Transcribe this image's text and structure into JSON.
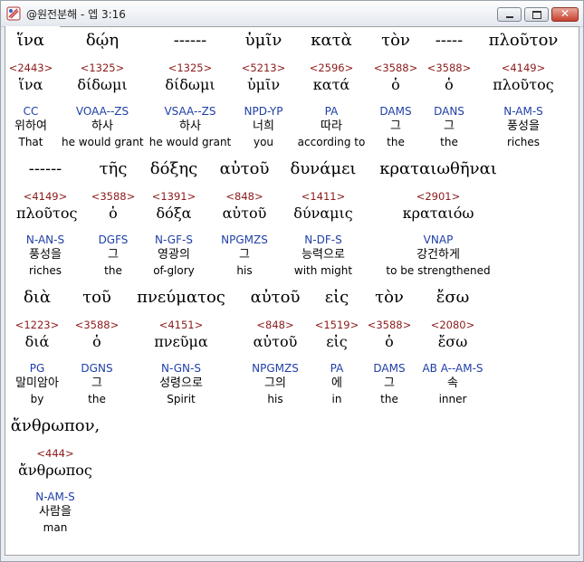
{
  "window": {
    "title": "@원전분해 - 엡 3:16"
  },
  "words": [
    {
      "greek": "ἵνα",
      "strong": "<2443>",
      "lemma": "ἵνα",
      "parse": "CC",
      "korean": "위하여",
      "english": "That"
    },
    {
      "greek": "δῴη",
      "strong": "<1325>",
      "lemma": "δίδωμι",
      "parse": "VOAA--ZS",
      "korean": "하사",
      "english": "he would grant"
    },
    {
      "greek": "------",
      "strong": "<1325>",
      "lemma": "δίδωμι",
      "parse": "VSAA--ZS",
      "korean": "하사",
      "english": "he would grant"
    },
    {
      "greek": "ὑμῖν",
      "strong": "<5213>",
      "lemma": "ὑμῖν",
      "parse": "NPD-YP",
      "korean": "너희",
      "english": "you"
    },
    {
      "greek": "κατὰ",
      "strong": "<2596>",
      "lemma": "κατά",
      "parse": "PA",
      "korean": "따라",
      "english": "according to"
    },
    {
      "greek": "τὸν",
      "strong": "<3588>",
      "lemma": "ὁ",
      "parse": "DAMS",
      "korean": "그",
      "english": "the"
    },
    {
      "greek": "-----",
      "strong": "<3588>",
      "lemma": "ὁ",
      "parse": "DANS",
      "korean": "그",
      "english": "the"
    },
    {
      "greek": "πλοῦτον",
      "strong": "<4149>",
      "lemma": "πλοῦτος",
      "parse": "N-AM-S",
      "korean": "풍성을",
      "english": "riches"
    },
    {
      "greek": "------",
      "strong": "<4149>",
      "lemma": "πλοῦτος",
      "parse": "N-AN-S",
      "korean": "풍성을",
      "english": "riches"
    },
    {
      "greek": "τῆς",
      "strong": "<3588>",
      "lemma": "ὁ",
      "parse": "DGFS",
      "korean": "그",
      "english": "the"
    },
    {
      "greek": "δόξης",
      "strong": "<1391>",
      "lemma": "δόξα",
      "parse": "N-GF-S",
      "korean": "영광의",
      "english": "of-glory"
    },
    {
      "greek": "αὐτοῦ",
      "strong": "<848>",
      "lemma": "αὐτοῦ",
      "parse": "NPGMZS",
      "korean": "그",
      "english": "his"
    },
    {
      "greek": "δυνάμει",
      "strong": "<1411>",
      "lemma": "δύναμις",
      "parse": "N-DF-S",
      "korean": "능력으로",
      "english": "with might"
    },
    {
      "greek": "κραταιωθῆναι",
      "strong": "<2901>",
      "lemma": "κραταιόω",
      "parse": "VNAP",
      "korean": "강건하게",
      "english": "to be strengthened"
    },
    {
      "greek": "διὰ",
      "strong": "<1223>",
      "lemma": "διά",
      "parse": "PG",
      "korean": "말미암아",
      "english": "by"
    },
    {
      "greek": "τοῦ",
      "strong": "<3588>",
      "lemma": "ὁ",
      "parse": "DGNS",
      "korean": "그",
      "english": "the"
    },
    {
      "greek": "πνεύματος",
      "strong": "<4151>",
      "lemma": "πνεῦμα",
      "parse": "N-GN-S",
      "korean": "성령으로",
      "english": "Spirit"
    },
    {
      "greek": "αὐτοῦ",
      "strong": "<848>",
      "lemma": "αὐτοῦ",
      "parse": "NPGMZS",
      "korean": "그의",
      "english": "his"
    },
    {
      "greek": "εἰς",
      "strong": "<1519>",
      "lemma": "εἰς",
      "parse": "PA",
      "korean": "에",
      "english": "in"
    },
    {
      "greek": "τὸν",
      "strong": "<3588>",
      "lemma": "ὁ",
      "parse": "DAMS",
      "korean": "그",
      "english": "the"
    },
    {
      "greek": "ἔσω",
      "strong": "<2080>",
      "lemma": "ἔσω",
      "parse": "AB A--AM-S",
      "korean": "속",
      "english": "inner"
    },
    {
      "greek": "ἄνθρωπον,",
      "strong": "<444>",
      "lemma": "ἄνθρωπος",
      "parse": "N-AM-S",
      "korean": "사람을",
      "english": "man"
    }
  ]
}
